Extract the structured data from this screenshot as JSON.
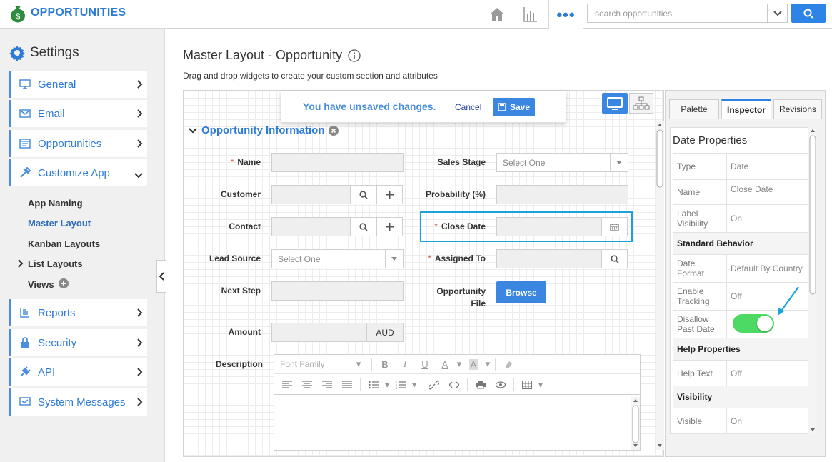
{
  "app": {
    "title": "OPPORTUNITIES",
    "more_label": "•••"
  },
  "search": {
    "placeholder": "search opportunities"
  },
  "sidebar": {
    "title": "Settings",
    "items": [
      {
        "label": "General"
      },
      {
        "label": "Email"
      },
      {
        "label": "Opportunities"
      },
      {
        "label": "Customize App"
      },
      {
        "label": "Reports"
      },
      {
        "label": "Security"
      },
      {
        "label": "API"
      },
      {
        "label": "System Messages"
      }
    ],
    "subitems": [
      {
        "label": "App Naming"
      },
      {
        "label": "Master Layout"
      },
      {
        "label": "Kanban Layouts"
      },
      {
        "label": "List Layouts"
      },
      {
        "label": "Views"
      }
    ]
  },
  "main": {
    "title": "Master Layout - Opportunity",
    "subtitle": "Drag and drop widgets to create your custom section and attributes",
    "unsaved": {
      "message": "You have unsaved changes.",
      "cancel": "Cancel",
      "save": "Save"
    },
    "section": {
      "title": "Opportunity Information"
    },
    "fields": {
      "name": "Name",
      "sales_stage": "Sales Stage",
      "sales_stage_value": "Select One",
      "customer": "Customer",
      "probability": "Probability (%)",
      "contact": "Contact",
      "close_date": "Close Date",
      "lead_source": "Lead Source",
      "lead_source_value": "Select One",
      "assigned_to": "Assigned To",
      "next_step": "Next Step",
      "opportunity_file": "Opportunity File",
      "browse": "Browse",
      "amount": "Amount",
      "currency": "AUD",
      "description": "Description",
      "font_family": "Font Family"
    }
  },
  "panel": {
    "tabs": [
      {
        "label": "Palette"
      },
      {
        "label": "Inspector"
      },
      {
        "label": "Revisions"
      }
    ],
    "heading": "Date Properties",
    "rows": {
      "type_k": "Type",
      "type_v": "Date",
      "name_k": "Name",
      "name_v": "Close Date",
      "labelvis_k": "Label Visibility",
      "labelvis_v": "On",
      "std_behavior": "Standard Behavior",
      "datefmt_k": "Date Format",
      "datefmt_v": "Default By Country",
      "tracking_k": "Enable Tracking",
      "tracking_v": "Off",
      "pastdate_k": "Disallow Past Date",
      "help_props": "Help Properties",
      "helptext_k": "Help Text",
      "helptext_v": "Off",
      "visibility": "Visibility",
      "visible_k": "Visible",
      "visible_v": "On"
    }
  },
  "colors": {
    "accent": "#2e7bd6",
    "highlight": "#1aa3d9",
    "toggle_on": "#4cd964"
  }
}
